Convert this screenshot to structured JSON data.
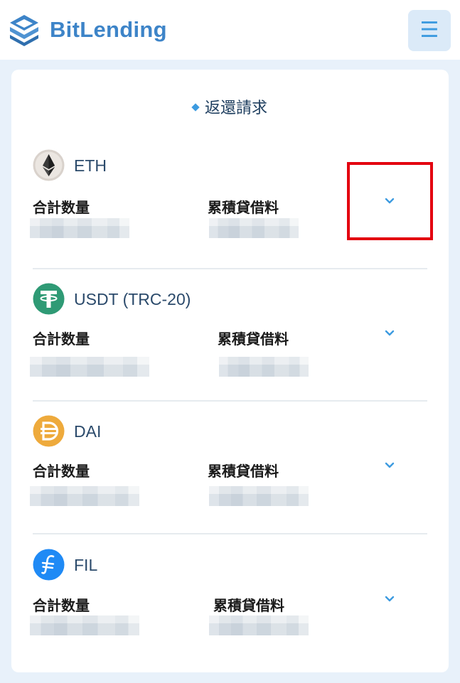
{
  "header": {
    "logo_text": "BitLending",
    "menu_icon": "☰"
  },
  "section": {
    "title": "返還請求"
  },
  "labels": {
    "total_quantity": "合計数量",
    "cumulative_fee": "累積貸借料"
  },
  "coins": [
    {
      "name": "ETH",
      "icon": "ethereum-icon",
      "color": "#d9d2cc"
    },
    {
      "name": "USDT (TRC-20)",
      "icon": "tether-icon",
      "color": "#2f9a75"
    },
    {
      "name": "DAI",
      "icon": "dai-icon",
      "color": "#eeaa3c"
    },
    {
      "name": "FIL",
      "icon": "filecoin-icon",
      "color": "#1f8af5"
    }
  ],
  "colors": {
    "brand": "#3d84c8",
    "accent": "#3d9be0",
    "highlight": "#e3000f",
    "background": "#e8f1fa"
  }
}
